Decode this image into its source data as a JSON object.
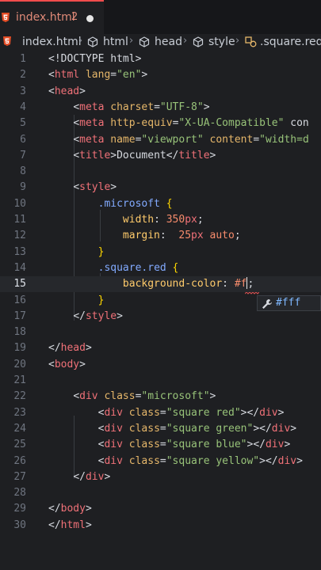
{
  "tab": {
    "label": "index.html",
    "problems": "2"
  },
  "breadcrumb": [
    {
      "label": "index.html",
      "icon": "html5-icon"
    },
    {
      "label": "html",
      "icon": "element-icon"
    },
    {
      "label": "head",
      "icon": "element-icon"
    },
    {
      "label": "style",
      "icon": "element-icon"
    },
    {
      "label": ".square.red",
      "icon": "css-rule-icon"
    }
  ],
  "editor": {
    "current_line": 15,
    "lines": [
      {
        "n": "1",
        "text": "<!DOCTYPE html>"
      },
      {
        "n": "2",
        "text": "<html lang=\"en\">"
      },
      {
        "n": "3",
        "text": "<head>"
      },
      {
        "n": "4",
        "text": "    <meta charset=\"UTF-8\">"
      },
      {
        "n": "5",
        "text": "    <meta http-equiv=\"X-UA-Compatible\" con"
      },
      {
        "n": "6",
        "text": "    <meta name=\"viewport\" content=\"width=d"
      },
      {
        "n": "7",
        "text": "    <title>Document</title>"
      },
      {
        "n": "8",
        "text": ""
      },
      {
        "n": "9",
        "text": "    <style>"
      },
      {
        "n": "10",
        "text": "        .microsoft {"
      },
      {
        "n": "11",
        "text": "            width: 350px;"
      },
      {
        "n": "12",
        "text": "            margin:  25px auto;"
      },
      {
        "n": "13",
        "text": "        }"
      },
      {
        "n": "14",
        "text": "        .square.red {"
      },
      {
        "n": "15",
        "text": "            background-color: #f;"
      },
      {
        "n": "16",
        "text": "        }"
      },
      {
        "n": "17",
        "text": "    </style>"
      },
      {
        "n": "18",
        "text": ""
      },
      {
        "n": "19",
        "text": "</head>"
      },
      {
        "n": "20",
        "text": "<body>"
      },
      {
        "n": "21",
        "text": ""
      },
      {
        "n": "22",
        "text": "    <div class=\"microsoft\">"
      },
      {
        "n": "23",
        "text": "        <div class=\"square red\"></div>"
      },
      {
        "n": "24",
        "text": "        <div class=\"square green\"></div>"
      },
      {
        "n": "25",
        "text": "        <div class=\"square blue\"></div>"
      },
      {
        "n": "26",
        "text": "        <div class=\"square yellow\"></div>"
      },
      {
        "n": "27",
        "text": "    </div>"
      },
      {
        "n": "28",
        "text": ""
      },
      {
        "n": "29",
        "text": "</body>"
      },
      {
        "n": "30",
        "text": "</html>"
      }
    ]
  },
  "suggestion": {
    "label": "#fff",
    "icon": "wrench-icon"
  },
  "colors": {
    "tab_accent": "#f14c4c",
    "tag": "#f07178",
    "attribute": "#e6b76a",
    "string": "#98c379",
    "selector": "#82aaff",
    "property": "#ffcb6b",
    "value": "#f78c6c"
  }
}
